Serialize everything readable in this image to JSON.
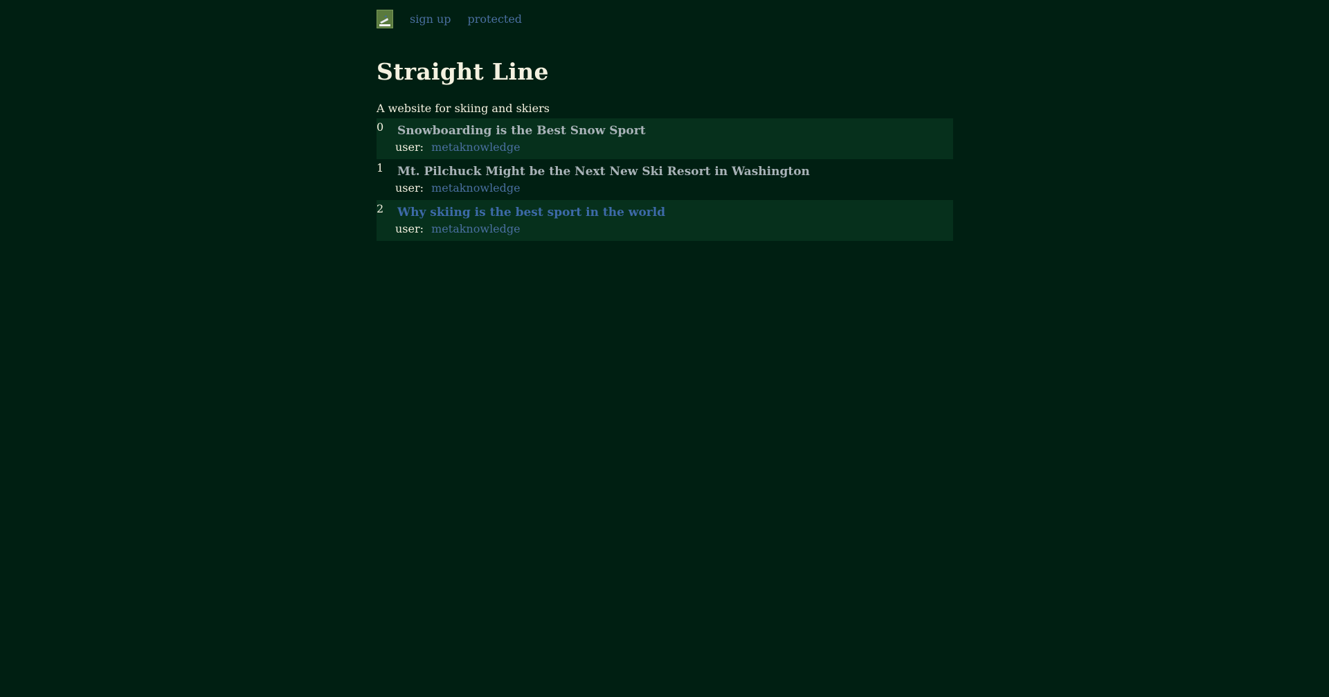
{
  "nav": {
    "logo_icon": "skier-logo-icon",
    "signup": "sign up",
    "protected": "protected"
  },
  "header": {
    "title": "Straight Line",
    "tagline": "A website for skiing and skiers"
  },
  "posts": [
    {
      "index": "0",
      "title": "Snowboarding is the Best Snow Sport",
      "user_label": "user:",
      "user": "metaknowledge"
    },
    {
      "index": "1",
      "title": "Mt. Pilchuck Might be the Next New Ski Resort in Washington",
      "user_label": "user:",
      "user": "metaknowledge"
    },
    {
      "index": "2",
      "title": "Why skiing is the best sport in the world",
      "user_label": "user:",
      "user": "metaknowledge"
    }
  ],
  "colors": {
    "background": "#001f12",
    "row_shade": "#06301c",
    "link": "#4a6fa0",
    "title_visited": "#a9b3b8",
    "text": "#f4f1e0"
  }
}
